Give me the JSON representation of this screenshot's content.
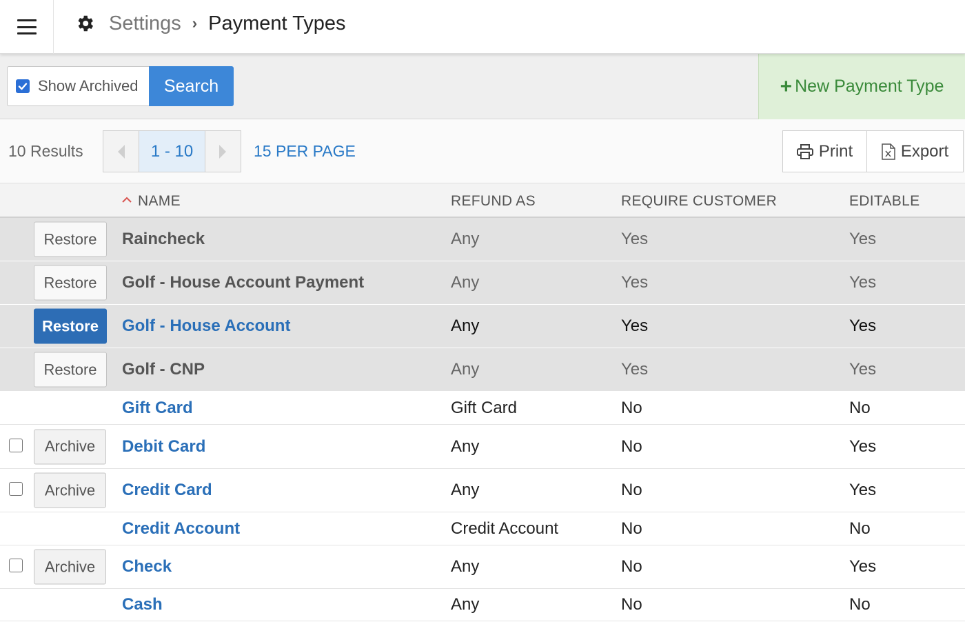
{
  "header": {
    "breadcrumb_root": "Settings",
    "breadcrumb_separator": "›",
    "page_title": "Payment Types"
  },
  "toolbar": {
    "show_archived_label": "Show Archived",
    "show_archived_checked": true,
    "search_label": "Search",
    "new_payment_type_label": "New Payment Type"
  },
  "pager": {
    "results_text": "10 Results",
    "range_text": "1 - 10",
    "per_page_text": "15 PER PAGE",
    "print_label": "Print",
    "export_label": "Export"
  },
  "table": {
    "columns": [
      "NAME",
      "REFUND AS",
      "REQUIRE CUSTOMER",
      "EDITABLE"
    ],
    "sort_column": "NAME",
    "sort_direction": "ascending",
    "rows": [
      {
        "action": "Restore",
        "name": "Raincheck",
        "refund_as": "Any",
        "require_customer": "Yes",
        "editable": "Yes"
      },
      {
        "action": "Restore",
        "name": "Golf - House Account Payment",
        "refund_as": "Any",
        "require_customer": "Yes",
        "editable": "Yes"
      },
      {
        "action": "Restore",
        "name": "Golf - House Account",
        "refund_as": "Any",
        "require_customer": "Yes",
        "editable": "Yes"
      },
      {
        "action": "Restore",
        "name": "Golf - CNP",
        "refund_as": "Any",
        "require_customer": "Yes",
        "editable": "Yes"
      },
      {
        "action": "",
        "name": "Gift Card",
        "refund_as": "Gift Card",
        "require_customer": "No",
        "editable": "No"
      },
      {
        "action": "Archive",
        "name": "Debit Card",
        "refund_as": "Any",
        "require_customer": "No",
        "editable": "Yes"
      },
      {
        "action": "Archive",
        "name": "Credit Card",
        "refund_as": "Any",
        "require_customer": "No",
        "editable": "Yes"
      },
      {
        "action": "",
        "name": "Credit Account",
        "refund_as": "Credit Account",
        "require_customer": "No",
        "editable": "No"
      },
      {
        "action": "Archive",
        "name": "Check",
        "refund_as": "Any",
        "require_customer": "No",
        "editable": "Yes"
      },
      {
        "action": "",
        "name": "Cash",
        "refund_as": "Any",
        "require_customer": "No",
        "editable": "No"
      }
    ]
  },
  "colors": {
    "link": "#2a6fb8",
    "primary_button": "#3d87d8",
    "new_button_bg": "#dff0d8",
    "new_button_text": "#3a8a3a",
    "archived_row_bg": "#e2e2e2"
  }
}
